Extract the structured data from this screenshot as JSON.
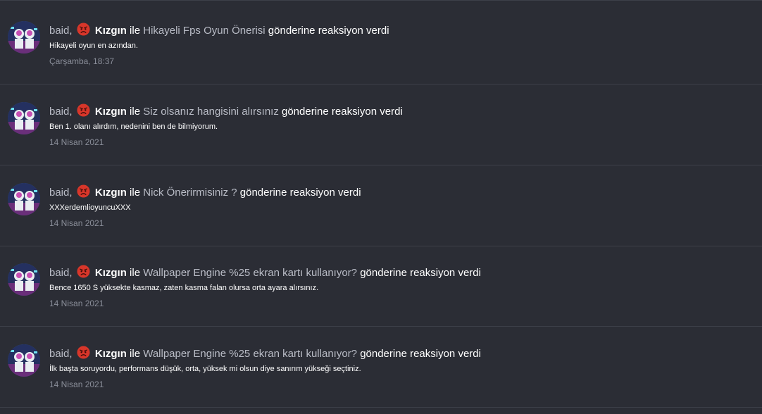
{
  "alerts": [
    {
      "user": "baid,",
      "reaction": "Kızgın",
      "connector": "ile",
      "thread": "Hikayeli Fps Oyun Önerisi",
      "suffix": "gönderine reaksiyon verdi",
      "snippet": "Hikayeli oyun en azından.",
      "date": "Çarşamba, 18:37"
    },
    {
      "user": "baid,",
      "reaction": "Kızgın",
      "connector": "ile",
      "thread": "Siz olsanız hangisini alırsınız",
      "suffix": "gönderine reaksiyon verdi",
      "snippet": "Ben 1. olanı alırdım, nedenini ben de bilmiyorum.",
      "date": "14 Nisan 2021"
    },
    {
      "user": "baid,",
      "reaction": "Kızgın",
      "connector": "ile",
      "thread": "Nick Önerirmisiniz ?",
      "suffix": "gönderine reaksiyon verdi",
      "snippet": "XXXerdemlioyuncuXXX",
      "date": "14 Nisan 2021"
    },
    {
      "user": "baid,",
      "reaction": "Kızgın",
      "connector": "ile",
      "thread": "Wallpaper Engine %25 ekran kartı kullanıyor?",
      "suffix": "gönderine reaksiyon verdi",
      "snippet": "Bence 1650 S yüksekte kasmaz, zaten kasma falan olursa orta ayara alırsınız.",
      "date": "14 Nisan 2021"
    },
    {
      "user": "baid,",
      "reaction": "Kızgın",
      "connector": "ile",
      "thread": "Wallpaper Engine %25 ekran kartı kullanıyor?",
      "suffix": "gönderine reaksiyon verdi",
      "snippet": "İlk başta soruyordu, performans düşük, orta, yüksek mi olsun diye sanırım yükseği seçtiniz.",
      "date": "14 Nisan 2021"
    }
  ],
  "icons": {
    "avatar": "user-avatar",
    "reaction": "angry-face-icon"
  },
  "colors": {
    "background": "#2b2d35",
    "divider": "#3d4049",
    "muted_text": "#b9bcc6",
    "date_text": "#8a8e99",
    "emoji_red": "#d8362a"
  }
}
